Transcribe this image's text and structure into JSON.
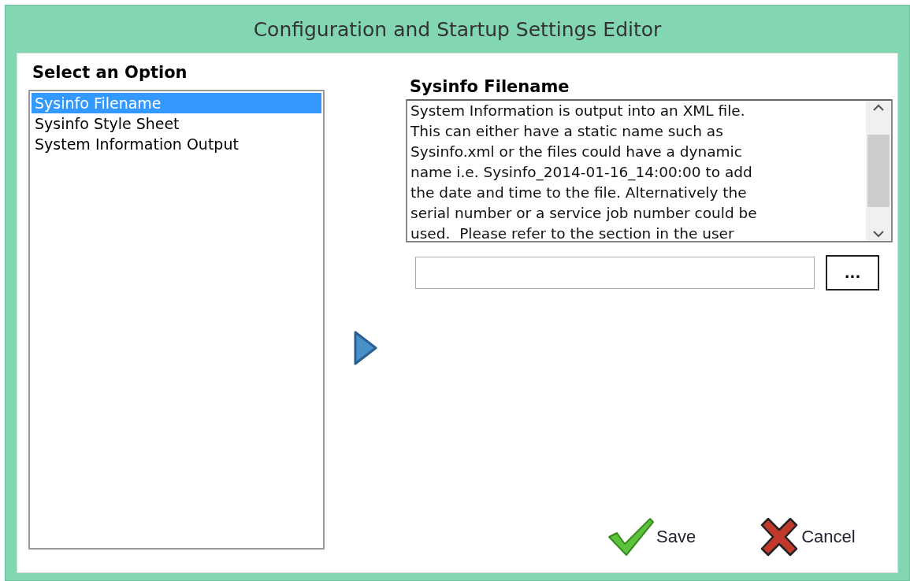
{
  "window": {
    "title": "Configuration and Startup Settings Editor"
  },
  "options": {
    "heading": "Select an Option",
    "items": [
      {
        "label": "Sysinfo Filename",
        "selected": true
      },
      {
        "label": "Sysinfo Style Sheet",
        "selected": false
      },
      {
        "label": "System Information Output",
        "selected": false
      }
    ]
  },
  "detail": {
    "heading": "Sysinfo Filename",
    "description_lines": [
      "System Information is output into an XML file.",
      "This can either have a static name such as",
      "Sysinfo.xml or the files could have a dynamic",
      "name i.e. Sysinfo_2014-01-16_14:00:00 to add",
      "the date and time to the file. Alternatively the",
      "serial number or a service job number could be",
      "used.  Please refer to the section in the user"
    ],
    "browse_button": "..."
  },
  "buttons": [
    {
      "kind": "save",
      "label": "Save"
    },
    {
      "kind": "cancel",
      "label": "Cancel"
    }
  ]
}
